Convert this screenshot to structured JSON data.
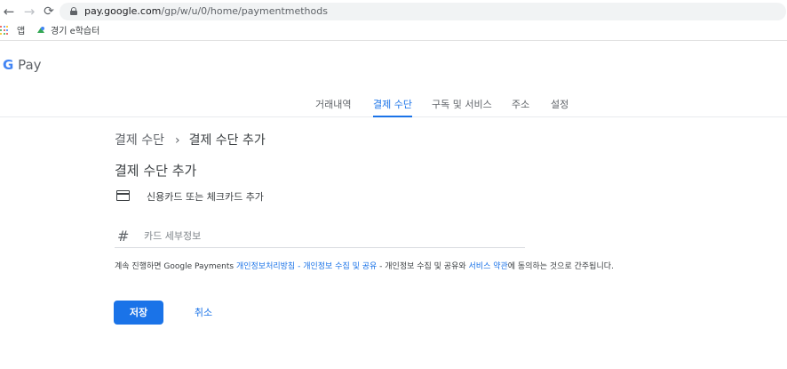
{
  "browser": {
    "url_host": "pay.google.com",
    "url_path": "/gp/w/u/0/home/paymentmethods",
    "bookmarks": [
      {
        "label": "앱"
      },
      {
        "label": "경기 e학습터"
      }
    ]
  },
  "app": {
    "logo_g": "G",
    "logo_text": "Pay"
  },
  "tabs": [
    {
      "label": "거래내역",
      "active": false
    },
    {
      "label": "결제 수단",
      "active": true
    },
    {
      "label": "구독 및 서비스",
      "active": false
    },
    {
      "label": "주소",
      "active": false
    },
    {
      "label": "설정",
      "active": false
    }
  ],
  "breadcrumb": {
    "parent": "결제 수단",
    "separator": "›",
    "current": "결제 수단 추가"
  },
  "main": {
    "title": "결제 수단 추가",
    "card_option_label": "신용카드 또는 체크카드 추가",
    "card_field_placeholder": "카드 세부정보",
    "card_field_icon": "#",
    "consent": {
      "prefix": "계속 진행하면 Google Payments ",
      "link_privacy": "개인정보처리방침",
      "sep1": " - ",
      "link_collection": "개인정보 수집 및 공유",
      "middle": " - 개인정보 수집 및 공유와 ",
      "link_terms": "서비스 약관",
      "suffix": "에 동의하는 것으로 간주됩니다."
    },
    "save_label": "저장",
    "cancel_label": "취소"
  },
  "colors": {
    "accent": "#1a73e8",
    "text": "#3c4043",
    "muted": "#5f6368"
  }
}
